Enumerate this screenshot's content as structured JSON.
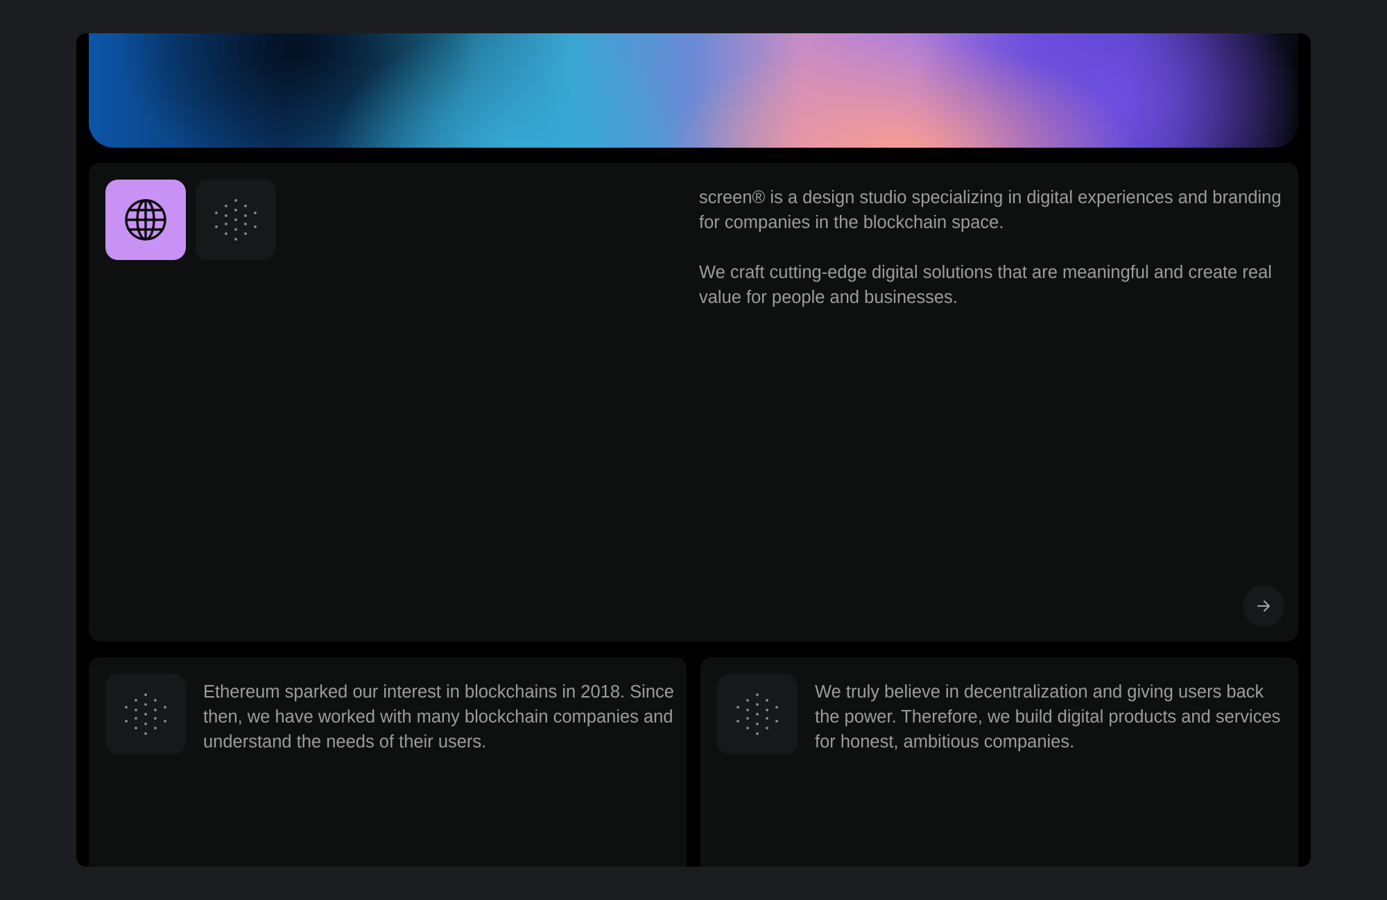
{
  "hero": {
    "colors": [
      "#0c55a7",
      "#3aa6d2",
      "#fc9e8e",
      "#6a4fd9",
      "#07080d"
    ]
  },
  "main": {
    "icons": [
      "globe-icon",
      "dotted-circle-icon"
    ],
    "globe_tile_color": "#c792f4",
    "paragraph_1": "screen® is a design studio specializing in digital experiences and branding for companies in the blockchain space.",
    "paragraph_2": "We craft cutting-edge digital solutions that are meaningful and create real value for people and businesses.",
    "next_button_icon": "arrow-right-icon"
  },
  "cards": [
    {
      "icon": "dotted-circle-icon",
      "text": "Ethereum sparked our interest in blockchains in 2018. Since then, we have worked with many blockchain companies and understand the needs of their users."
    },
    {
      "icon": "dotted-circle-icon",
      "text": "We truly believe in decentralization and giving users back the power. Therefore, we build digital products and services for honest, ambitious companies."
    }
  ]
}
